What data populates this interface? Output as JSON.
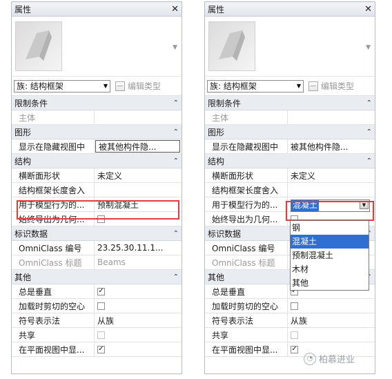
{
  "panel": {
    "title": "属性",
    "close_glyph": "✕",
    "family_type": "族: 结构框架",
    "edit_type": "编辑类型",
    "preview_icon": "beam-preview-icon"
  },
  "categories": {
    "constraints": "限制条件",
    "graphics": "图形",
    "structure": "结构",
    "identity": "标识数据",
    "other": "其他"
  },
  "rows": {
    "host": "主体",
    "show_hidden": "显示在隐藏视图中",
    "show_hidden_value": "被其他构件隐...",
    "section_shape": "横断面形状",
    "section_shape_value": "未定义",
    "frame_length_rounding": "结构框架长度舍入",
    "model_material": "用于模型行为的...",
    "model_material_value_left": "预制混凝土",
    "model_material_value_right": "混凝土",
    "always_export": "始终导出为几何...",
    "omniclass_number": "OmniClass 编号",
    "omniclass_number_value": "23.25.30.11.1...",
    "omniclass_title": "OmniClass 标题",
    "omniclass_title_value": "Beams",
    "always_vertical": "总是垂直",
    "cut_void_on_load": "加载时剪切的空心",
    "symbol_rep": "符号表示法",
    "symbol_rep_value": "从族",
    "shared": "共享",
    "show_in_plan": "在平面视图中显..."
  },
  "dropdown_options": [
    "钢",
    "混凝土",
    "预制混凝土",
    "木材",
    "其他"
  ],
  "dropdown_selected": "混凝土",
  "check_glyph": "✓",
  "watermark": "柏慕进业",
  "colors": {
    "highlight": "#e23b3b",
    "selection": "#2f6fd4",
    "category_bg": "#e9ecf1"
  }
}
